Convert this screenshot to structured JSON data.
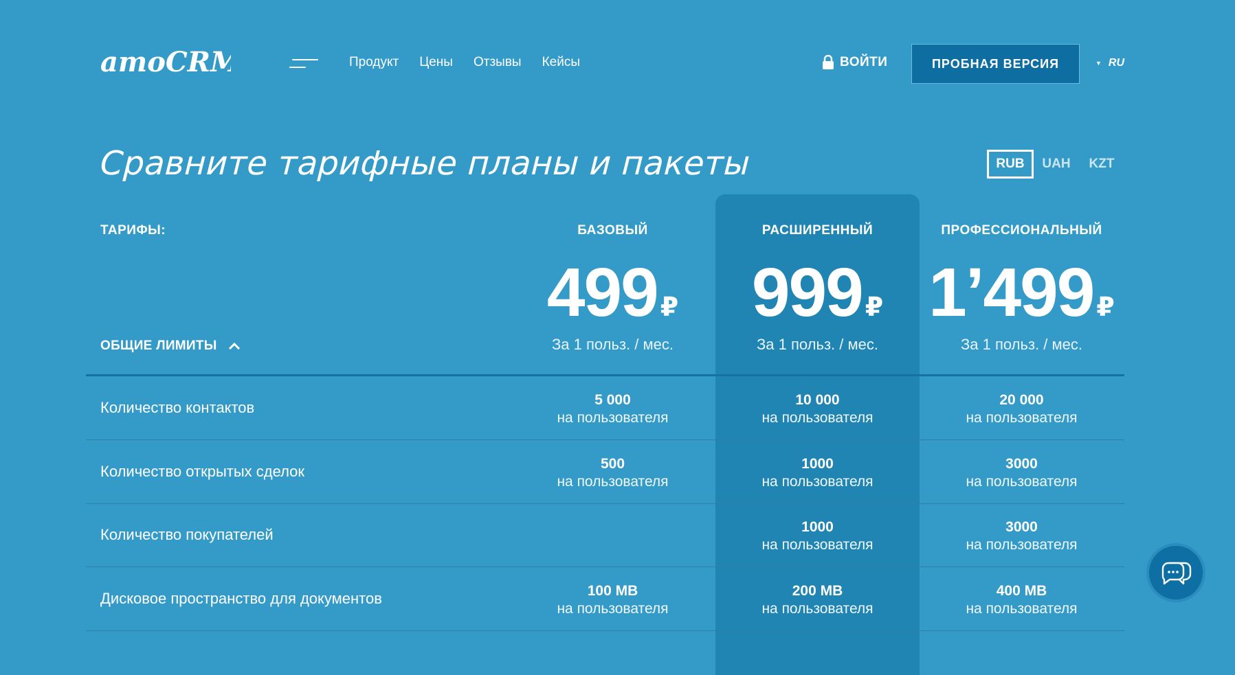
{
  "header": {
    "logo_text": "amoCRM.",
    "nav": [
      "Продукт",
      "Цены",
      "Отзывы",
      "Кейсы"
    ],
    "login_label": "ВОЙТИ",
    "trial_label": "ПРОБНАЯ ВЕРСИЯ",
    "language": "RU"
  },
  "page_title": "Сравните тарифные планы и пакеты",
  "currency": {
    "options": [
      "RUB",
      "UAH",
      "KZT"
    ],
    "selected": "RUB"
  },
  "tariffs_label": "ТАРИФЫ:",
  "plans": [
    {
      "name": "БАЗОВЫЙ",
      "price": "499",
      "currency_symbol": "₽",
      "period": "За 1 польз. / мес."
    },
    {
      "name": "РАСШИРЕННЫЙ",
      "price": "999",
      "currency_symbol": "₽",
      "period": "За 1 польз. / мес.",
      "highlighted": true
    },
    {
      "name": "ПРОФЕССИОНАЛЬНЫЙ",
      "price": "1’499",
      "currency_symbol": "₽",
      "period": "За 1 польз. / мес."
    }
  ],
  "section": {
    "title": "ОБЩИЕ ЛИМИТЫ",
    "expanded": true
  },
  "rows": [
    {
      "label": "Количество контактов",
      "values": [
        {
          "value": "5 000",
          "unit": "на пользователя"
        },
        {
          "value": "10 000",
          "unit": "на пользователя"
        },
        {
          "value": "20 000",
          "unit": "на пользователя"
        }
      ]
    },
    {
      "label": "Количество открытых сделок",
      "values": [
        {
          "value": "500",
          "unit": "на пользователя"
        },
        {
          "value": "1000",
          "unit": "на пользователя"
        },
        {
          "value": "3000",
          "unit": "на пользователя"
        }
      ]
    },
    {
      "label": "Количество покупателей",
      "values": [
        {
          "value": "",
          "unit": ""
        },
        {
          "value": "1000",
          "unit": "на пользователя"
        },
        {
          "value": "3000",
          "unit": "на пользователя"
        }
      ]
    },
    {
      "label": "Дисковое пространство для документов",
      "values": [
        {
          "value": "100 MB",
          "unit": "на пользователя"
        },
        {
          "value": "200 MB",
          "unit": "на пользователя"
        },
        {
          "value": "400 MB",
          "unit": "на пользователя"
        }
      ]
    }
  ],
  "colors": {
    "background": "#349bc8",
    "highlight_column": "#2185b3",
    "button": "#0e6ea2"
  },
  "icons": {
    "menu": "hamburger-icon",
    "login": "lock-icon",
    "section_toggle": "chevron-up-icon",
    "chat": "chat-bubbles-icon"
  }
}
